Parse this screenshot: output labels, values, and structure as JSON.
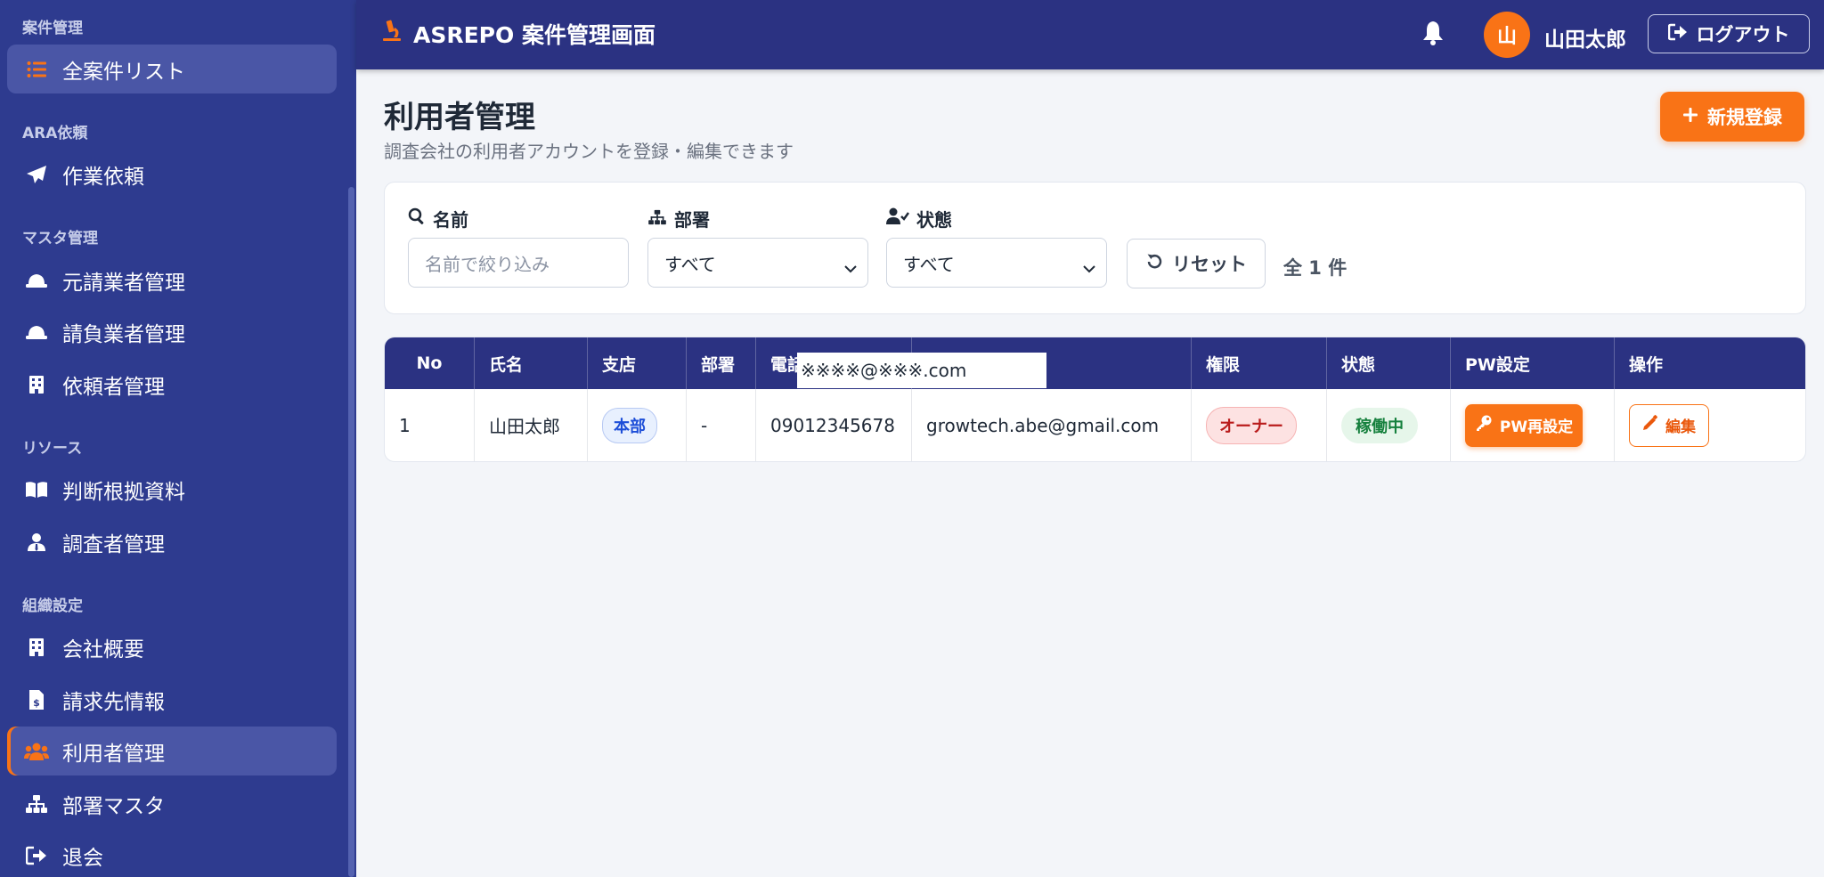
{
  "app": {
    "title": "ASREPO 案件管理画面"
  },
  "header": {
    "avatar_initial": "山",
    "user_name": "山田太郎",
    "logout_label": "ログアウト"
  },
  "sidebar": {
    "sections": [
      {
        "label": "案件管理"
      },
      {
        "label": "ARA依頼"
      },
      {
        "label": "マスタ管理"
      },
      {
        "label": "リソース"
      },
      {
        "label": "組織設定"
      }
    ],
    "items": [
      {
        "label": "全案件リスト",
        "icon": "list-icon",
        "active": true
      },
      {
        "label": "作業依頼",
        "icon": "paper-plane-icon"
      },
      {
        "label": "元請業者管理",
        "icon": "hard-hat-icon"
      },
      {
        "label": "請負業者管理",
        "icon": "hard-hat-icon"
      },
      {
        "label": "依頼者管理",
        "icon": "building-icon"
      },
      {
        "label": "判断根拠資料",
        "icon": "book-icon"
      },
      {
        "label": "調査者管理",
        "icon": "user-tie-icon"
      },
      {
        "label": "会社概要",
        "icon": "building-icon"
      },
      {
        "label": "請求先情報",
        "icon": "invoice-icon"
      },
      {
        "label": "利用者管理",
        "icon": "users-icon",
        "active": true
      },
      {
        "label": "部署マスタ",
        "icon": "sitemap-icon"
      },
      {
        "label": "退会",
        "icon": "sign-out-icon"
      }
    ]
  },
  "page": {
    "title": "利用者管理",
    "subtitle": "調査会社の利用者アカウントを登録・編集できます",
    "new_button": "新規登録"
  },
  "filters": {
    "name_label": "名前",
    "name_placeholder": "名前で絞り込み",
    "dept_label": "部署",
    "dept_value": "すべて",
    "status_label": "状態",
    "status_value": "すべて",
    "reset_label": "リセット",
    "count_text": "全 1 件"
  },
  "table": {
    "columns": [
      "No",
      "氏名",
      "支店",
      "部署",
      "電話",
      "",
      "権限",
      "状態",
      "PW設定",
      "操作"
    ],
    "redacted_header": "※※※※@※※※.com",
    "rows": [
      {
        "no": "1",
        "name": "山田太郎",
        "branch": "本部",
        "dept": "-",
        "phone": "09012345678",
        "email": "growtech.abe@gmail.com",
        "role": "オーナー",
        "status": "稼働中",
        "pw_button": "PW再設定",
        "edit_button": "編集"
      }
    ]
  },
  "colors": {
    "sidebar_bg": "#2e3b8f",
    "topbar_bg": "#2b3282",
    "accent": "#f97316",
    "page_bg": "#f3f5f9"
  }
}
